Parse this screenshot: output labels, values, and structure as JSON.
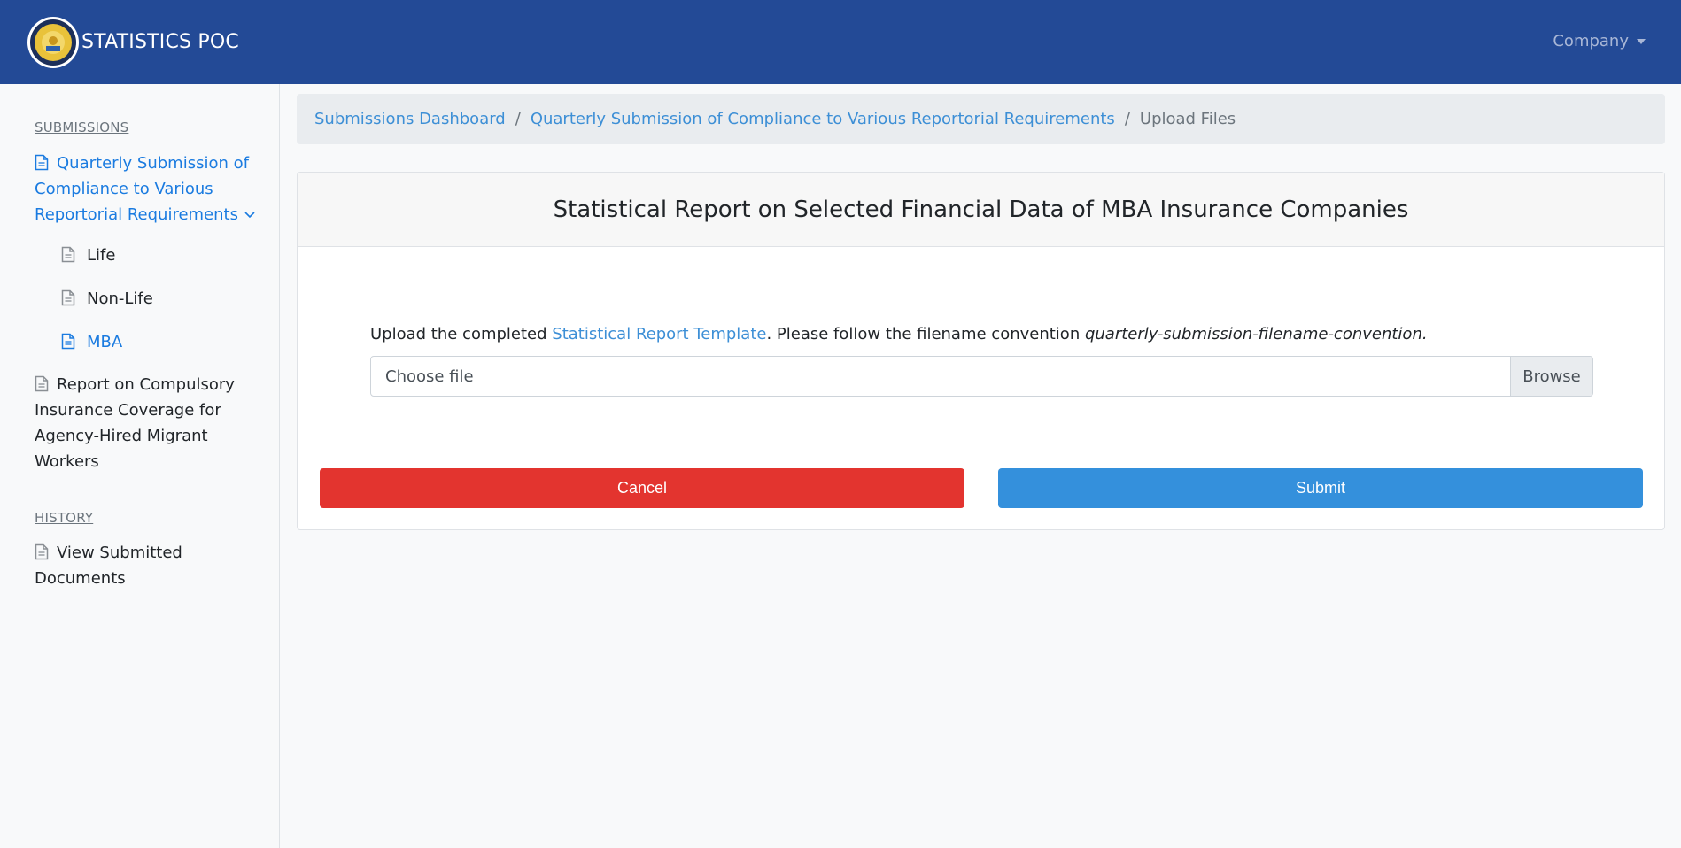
{
  "header": {
    "app_title": "STATISTICS POC",
    "company_menu": "Company"
  },
  "sidebar": {
    "submissions_heading": "SUBMISSIONS",
    "quarterly": {
      "line1": "Quarterly Submission of",
      "line2": "Compliance to Various",
      "line3": "Reportorial Requirements"
    },
    "sub_items": [
      "Life",
      "Non-Life",
      "MBA"
    ],
    "compulsory": {
      "line1": "Report on Compulsory",
      "line2": "Insurance Coverage for",
      "line3": "Agency-Hired Migrant",
      "line4": "Workers"
    },
    "history_heading": "HISTORY",
    "view_submitted": {
      "line1": "View Submitted",
      "line2": "Documents"
    }
  },
  "breadcrumb": {
    "dashboard": "Submissions Dashboard",
    "separator": "/",
    "quarterly": "Quarterly Submission of Compliance to Various Reportorial Requirements",
    "current": "Upload Files"
  },
  "card": {
    "title": "Statistical Report on Selected Financial Data of MBA Insurance Companies",
    "instructions_prefix": "Upload the completed ",
    "template_link": "Statistical Report Template",
    "instructions_middle": ". Please follow the filename convention ",
    "filename_convention": "quarterly-submission-filename-convention.",
    "file_placeholder": "Choose file",
    "browse_label": "Browse",
    "cancel_label": "Cancel",
    "submit_label": "Submit"
  },
  "colors": {
    "header_bg": "#234a96",
    "link": "#3d8fd6",
    "active_nav": "#1a7be0",
    "cancel": "#e3342f",
    "submit": "#3490dc"
  },
  "icons": {
    "logo": "seal-logo",
    "nav": "document-icon",
    "expand": "chevron-down-icon",
    "dropdown": "caret-down-icon"
  }
}
